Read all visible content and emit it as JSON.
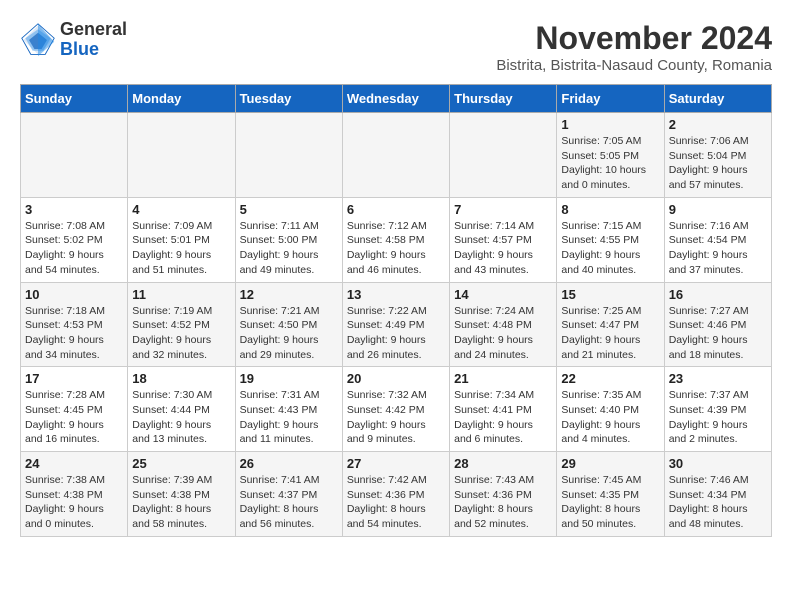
{
  "header": {
    "logo": {
      "general": "General",
      "blue": "Blue"
    },
    "title": "November 2024",
    "subtitle": "Bistrita, Bistrita-Nasaud County, Romania"
  },
  "weekdays": [
    "Sunday",
    "Monday",
    "Tuesday",
    "Wednesday",
    "Thursday",
    "Friday",
    "Saturday"
  ],
  "weeks": [
    [
      {
        "day": "",
        "info": ""
      },
      {
        "day": "",
        "info": ""
      },
      {
        "day": "",
        "info": ""
      },
      {
        "day": "",
        "info": ""
      },
      {
        "day": "",
        "info": ""
      },
      {
        "day": "1",
        "info": "Sunrise: 7:05 AM\nSunset: 5:05 PM\nDaylight: 10 hours and 0 minutes."
      },
      {
        "day": "2",
        "info": "Sunrise: 7:06 AM\nSunset: 5:04 PM\nDaylight: 9 hours and 57 minutes."
      }
    ],
    [
      {
        "day": "3",
        "info": "Sunrise: 7:08 AM\nSunset: 5:02 PM\nDaylight: 9 hours and 54 minutes."
      },
      {
        "day": "4",
        "info": "Sunrise: 7:09 AM\nSunset: 5:01 PM\nDaylight: 9 hours and 51 minutes."
      },
      {
        "day": "5",
        "info": "Sunrise: 7:11 AM\nSunset: 5:00 PM\nDaylight: 9 hours and 49 minutes."
      },
      {
        "day": "6",
        "info": "Sunrise: 7:12 AM\nSunset: 4:58 PM\nDaylight: 9 hours and 46 minutes."
      },
      {
        "day": "7",
        "info": "Sunrise: 7:14 AM\nSunset: 4:57 PM\nDaylight: 9 hours and 43 minutes."
      },
      {
        "day": "8",
        "info": "Sunrise: 7:15 AM\nSunset: 4:55 PM\nDaylight: 9 hours and 40 minutes."
      },
      {
        "day": "9",
        "info": "Sunrise: 7:16 AM\nSunset: 4:54 PM\nDaylight: 9 hours and 37 minutes."
      }
    ],
    [
      {
        "day": "10",
        "info": "Sunrise: 7:18 AM\nSunset: 4:53 PM\nDaylight: 9 hours and 34 minutes."
      },
      {
        "day": "11",
        "info": "Sunrise: 7:19 AM\nSunset: 4:52 PM\nDaylight: 9 hours and 32 minutes."
      },
      {
        "day": "12",
        "info": "Sunrise: 7:21 AM\nSunset: 4:50 PM\nDaylight: 9 hours and 29 minutes."
      },
      {
        "day": "13",
        "info": "Sunrise: 7:22 AM\nSunset: 4:49 PM\nDaylight: 9 hours and 26 minutes."
      },
      {
        "day": "14",
        "info": "Sunrise: 7:24 AM\nSunset: 4:48 PM\nDaylight: 9 hours and 24 minutes."
      },
      {
        "day": "15",
        "info": "Sunrise: 7:25 AM\nSunset: 4:47 PM\nDaylight: 9 hours and 21 minutes."
      },
      {
        "day": "16",
        "info": "Sunrise: 7:27 AM\nSunset: 4:46 PM\nDaylight: 9 hours and 18 minutes."
      }
    ],
    [
      {
        "day": "17",
        "info": "Sunrise: 7:28 AM\nSunset: 4:45 PM\nDaylight: 9 hours and 16 minutes."
      },
      {
        "day": "18",
        "info": "Sunrise: 7:30 AM\nSunset: 4:44 PM\nDaylight: 9 hours and 13 minutes."
      },
      {
        "day": "19",
        "info": "Sunrise: 7:31 AM\nSunset: 4:43 PM\nDaylight: 9 hours and 11 minutes."
      },
      {
        "day": "20",
        "info": "Sunrise: 7:32 AM\nSunset: 4:42 PM\nDaylight: 9 hours and 9 minutes."
      },
      {
        "day": "21",
        "info": "Sunrise: 7:34 AM\nSunset: 4:41 PM\nDaylight: 9 hours and 6 minutes."
      },
      {
        "day": "22",
        "info": "Sunrise: 7:35 AM\nSunset: 4:40 PM\nDaylight: 9 hours and 4 minutes."
      },
      {
        "day": "23",
        "info": "Sunrise: 7:37 AM\nSunset: 4:39 PM\nDaylight: 9 hours and 2 minutes."
      }
    ],
    [
      {
        "day": "24",
        "info": "Sunrise: 7:38 AM\nSunset: 4:38 PM\nDaylight: 9 hours and 0 minutes."
      },
      {
        "day": "25",
        "info": "Sunrise: 7:39 AM\nSunset: 4:38 PM\nDaylight: 8 hours and 58 minutes."
      },
      {
        "day": "26",
        "info": "Sunrise: 7:41 AM\nSunset: 4:37 PM\nDaylight: 8 hours and 56 minutes."
      },
      {
        "day": "27",
        "info": "Sunrise: 7:42 AM\nSunset: 4:36 PM\nDaylight: 8 hours and 54 minutes."
      },
      {
        "day": "28",
        "info": "Sunrise: 7:43 AM\nSunset: 4:36 PM\nDaylight: 8 hours and 52 minutes."
      },
      {
        "day": "29",
        "info": "Sunrise: 7:45 AM\nSunset: 4:35 PM\nDaylight: 8 hours and 50 minutes."
      },
      {
        "day": "30",
        "info": "Sunrise: 7:46 AM\nSunset: 4:34 PM\nDaylight: 8 hours and 48 minutes."
      }
    ]
  ]
}
